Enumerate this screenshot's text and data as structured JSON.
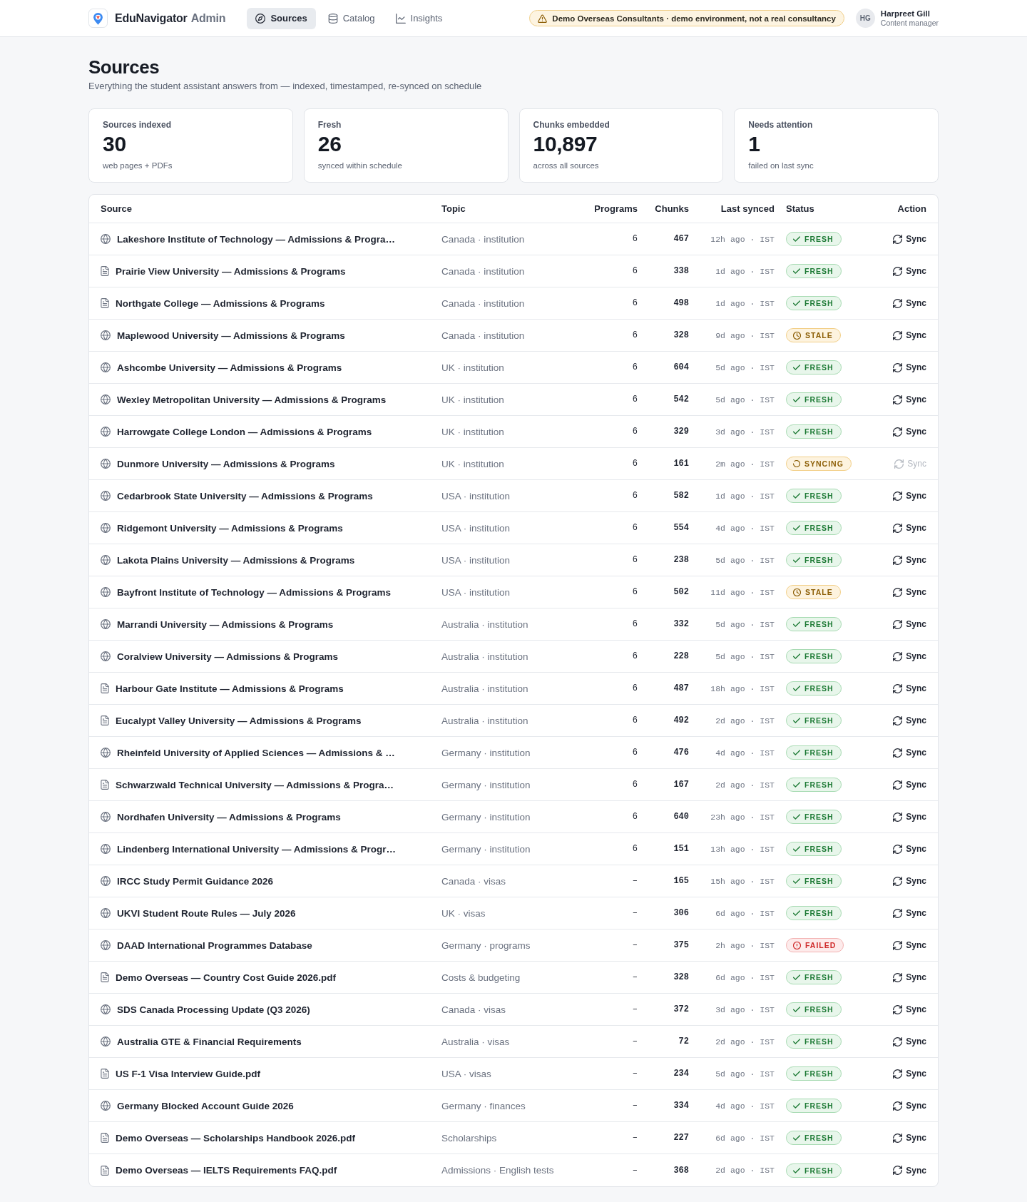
{
  "header": {
    "brand": {
      "name": "EduNavigator",
      "suffix": "Admin"
    },
    "nav": [
      {
        "label": "Sources",
        "selected": true
      },
      {
        "label": "Catalog",
        "selected": false
      },
      {
        "label": "Insights",
        "selected": false
      }
    ],
    "banner": {
      "text": "Demo Overseas Consultants · demo environment, not a real consultancy"
    },
    "user": {
      "initials": "HG",
      "name": "Harpreet Gill",
      "role": "Content manager"
    }
  },
  "page": {
    "title": "Sources",
    "subtitle": "Everything the student assistant answers from — indexed, timestamped, re-synced on schedule"
  },
  "stats": [
    {
      "label": "Sources indexed",
      "value": "30",
      "note": "web pages + PDFs"
    },
    {
      "label": "Fresh",
      "value": "26",
      "note": "synced within schedule"
    },
    {
      "label": "Chunks embedded",
      "value": "10,897",
      "note": "across all sources"
    },
    {
      "label": "Needs attention",
      "value": "1",
      "note": "failed on last sync"
    }
  ],
  "table": {
    "columns": [
      "Source",
      "Topic",
      "Programs",
      "Chunks",
      "Last synced",
      "Status",
      "Action"
    ],
    "rows": [
      {
        "kind": "web",
        "source": "Lakeshore Institute of Technology — Admissions & Progra…",
        "topic": "Canada · institution",
        "programs": "6",
        "chunks": "467",
        "last_synced": "12h ago · IST",
        "status": {
          "kind": "fresh",
          "label": "FRESH"
        },
        "action": {
          "label": "Sync",
          "disabled": false
        }
      },
      {
        "kind": "document",
        "source": "Prairie View University — Admissions & Programs",
        "topic": "Canada · institution",
        "programs": "6",
        "chunks": "338",
        "last_synced": "1d ago · IST",
        "status": {
          "kind": "fresh",
          "label": "FRESH"
        },
        "action": {
          "label": "Sync",
          "disabled": false
        }
      },
      {
        "kind": "document",
        "source": "Northgate College — Admissions & Programs",
        "topic": "Canada · institution",
        "programs": "6",
        "chunks": "498",
        "last_synced": "1d ago · IST",
        "status": {
          "kind": "fresh",
          "label": "FRESH"
        },
        "action": {
          "label": "Sync",
          "disabled": false
        }
      },
      {
        "kind": "web",
        "source": "Maplewood University — Admissions & Programs",
        "topic": "Canada · institution",
        "programs": "6",
        "chunks": "328",
        "last_synced": "9d ago · IST",
        "status": {
          "kind": "stale",
          "label": "STALE"
        },
        "action": {
          "label": "Sync",
          "disabled": false
        }
      },
      {
        "kind": "web",
        "source": "Ashcombe University — Admissions & Programs",
        "topic": "UK · institution",
        "programs": "6",
        "chunks": "604",
        "last_synced": "5d ago · IST",
        "status": {
          "kind": "fresh",
          "label": "FRESH"
        },
        "action": {
          "label": "Sync",
          "disabled": false
        }
      },
      {
        "kind": "web",
        "source": "Wexley Metropolitan University — Admissions & Programs",
        "topic": "UK · institution",
        "programs": "6",
        "chunks": "542",
        "last_synced": "5d ago · IST",
        "status": {
          "kind": "fresh",
          "label": "FRESH"
        },
        "action": {
          "label": "Sync",
          "disabled": false
        }
      },
      {
        "kind": "web",
        "source": "Harrowgate College London — Admissions & Programs",
        "topic": "UK · institution",
        "programs": "6",
        "chunks": "329",
        "last_synced": "3d ago · IST",
        "status": {
          "kind": "fresh",
          "label": "FRESH"
        },
        "action": {
          "label": "Sync",
          "disabled": false
        }
      },
      {
        "kind": "web",
        "source": "Dunmore University — Admissions & Programs",
        "topic": "UK · institution",
        "programs": "6",
        "chunks": "161",
        "last_synced": "2m ago · IST",
        "status": {
          "kind": "syncing",
          "label": "SYNCING"
        },
        "action": {
          "label": "Sync",
          "disabled": true
        }
      },
      {
        "kind": "web",
        "source": "Cedarbrook State University — Admissions & Programs",
        "topic": "USA · institution",
        "programs": "6",
        "chunks": "582",
        "last_synced": "1d ago · IST",
        "status": {
          "kind": "fresh",
          "label": "FRESH"
        },
        "action": {
          "label": "Sync",
          "disabled": false
        }
      },
      {
        "kind": "web",
        "source": "Ridgemont University — Admissions & Programs",
        "topic": "USA · institution",
        "programs": "6",
        "chunks": "554",
        "last_synced": "4d ago · IST",
        "status": {
          "kind": "fresh",
          "label": "FRESH"
        },
        "action": {
          "label": "Sync",
          "disabled": false
        }
      },
      {
        "kind": "web",
        "source": "Lakota Plains University — Admissions & Programs",
        "topic": "USA · institution",
        "programs": "6",
        "chunks": "238",
        "last_synced": "5d ago · IST",
        "status": {
          "kind": "fresh",
          "label": "FRESH"
        },
        "action": {
          "label": "Sync",
          "disabled": false
        }
      },
      {
        "kind": "web",
        "source": "Bayfront Institute of Technology — Admissions & Programs",
        "topic": "USA · institution",
        "programs": "6",
        "chunks": "502",
        "last_synced": "11d ago · IST",
        "status": {
          "kind": "stale",
          "label": "STALE"
        },
        "action": {
          "label": "Sync",
          "disabled": false
        }
      },
      {
        "kind": "web",
        "source": "Marrandi University — Admissions & Programs",
        "topic": "Australia · institution",
        "programs": "6",
        "chunks": "332",
        "last_synced": "5d ago · IST",
        "status": {
          "kind": "fresh",
          "label": "FRESH"
        },
        "action": {
          "label": "Sync",
          "disabled": false
        }
      },
      {
        "kind": "web",
        "source": "Coralview University — Admissions & Programs",
        "topic": "Australia · institution",
        "programs": "6",
        "chunks": "228",
        "last_synced": "5d ago · IST",
        "status": {
          "kind": "fresh",
          "label": "FRESH"
        },
        "action": {
          "label": "Sync",
          "disabled": false
        }
      },
      {
        "kind": "document",
        "source": "Harbour Gate Institute — Admissions & Programs",
        "topic": "Australia · institution",
        "programs": "6",
        "chunks": "487",
        "last_synced": "18h ago · IST",
        "status": {
          "kind": "fresh",
          "label": "FRESH"
        },
        "action": {
          "label": "Sync",
          "disabled": false
        }
      },
      {
        "kind": "document",
        "source": "Eucalypt Valley University — Admissions & Programs",
        "topic": "Australia · institution",
        "programs": "6",
        "chunks": "492",
        "last_synced": "2d ago · IST",
        "status": {
          "kind": "fresh",
          "label": "FRESH"
        },
        "action": {
          "label": "Sync",
          "disabled": false
        }
      },
      {
        "kind": "web",
        "source": "Rheinfeld University of Applied Sciences — Admissions & …",
        "topic": "Germany · institution",
        "programs": "6",
        "chunks": "476",
        "last_synced": "4d ago · IST",
        "status": {
          "kind": "fresh",
          "label": "FRESH"
        },
        "action": {
          "label": "Sync",
          "disabled": false
        }
      },
      {
        "kind": "document",
        "source": "Schwarzwald Technical University — Admissions & Progra…",
        "topic": "Germany · institution",
        "programs": "6",
        "chunks": "167",
        "last_synced": "2d ago · IST",
        "status": {
          "kind": "fresh",
          "label": "FRESH"
        },
        "action": {
          "label": "Sync",
          "disabled": false
        }
      },
      {
        "kind": "web",
        "source": "Nordhafen University — Admissions & Programs",
        "topic": "Germany · institution",
        "programs": "6",
        "chunks": "640",
        "last_synced": "23h ago · IST",
        "status": {
          "kind": "fresh",
          "label": "FRESH"
        },
        "action": {
          "label": "Sync",
          "disabled": false
        }
      },
      {
        "kind": "web",
        "source": "Lindenberg International University — Admissions & Progr…",
        "topic": "Germany · institution",
        "programs": "6",
        "chunks": "151",
        "last_synced": "13h ago · IST",
        "status": {
          "kind": "fresh",
          "label": "FRESH"
        },
        "action": {
          "label": "Sync",
          "disabled": false
        }
      },
      {
        "kind": "web",
        "source": "IRCC Study Permit Guidance 2026",
        "topic": "Canada · visas",
        "programs": "–",
        "chunks": "165",
        "last_synced": "15h ago · IST",
        "status": {
          "kind": "fresh",
          "label": "FRESH"
        },
        "action": {
          "label": "Sync",
          "disabled": false
        }
      },
      {
        "kind": "web",
        "source": "UKVI Student Route Rules — July 2026",
        "topic": "UK · visas",
        "programs": "–",
        "chunks": "306",
        "last_synced": "6d ago · IST",
        "status": {
          "kind": "fresh",
          "label": "FRESH"
        },
        "action": {
          "label": "Sync",
          "disabled": false
        }
      },
      {
        "kind": "web",
        "source": "DAAD International Programmes Database",
        "topic": "Germany · programs",
        "programs": "–",
        "chunks": "375",
        "last_synced": "2h ago · IST",
        "status": {
          "kind": "failed",
          "label": "FAILED"
        },
        "action": {
          "label": "Sync",
          "disabled": false
        }
      },
      {
        "kind": "document",
        "source": "Demo Overseas — Country Cost Guide 2026.pdf",
        "topic": "Costs & budgeting",
        "programs": "–",
        "chunks": "328",
        "last_synced": "6d ago · IST",
        "status": {
          "kind": "fresh",
          "label": "FRESH"
        },
        "action": {
          "label": "Sync",
          "disabled": false
        }
      },
      {
        "kind": "web",
        "source": "SDS Canada Processing Update (Q3 2026)",
        "topic": "Canada · visas",
        "programs": "–",
        "chunks": "372",
        "last_synced": "3d ago · IST",
        "status": {
          "kind": "fresh",
          "label": "FRESH"
        },
        "action": {
          "label": "Sync",
          "disabled": false
        }
      },
      {
        "kind": "web",
        "source": "Australia GTE & Financial Requirements",
        "topic": "Australia · visas",
        "programs": "–",
        "chunks": "72",
        "last_synced": "2d ago · IST",
        "status": {
          "kind": "fresh",
          "label": "FRESH"
        },
        "action": {
          "label": "Sync",
          "disabled": false
        }
      },
      {
        "kind": "document",
        "source": "US F-1 Visa Interview Guide.pdf",
        "topic": "USA · visas",
        "programs": "–",
        "chunks": "234",
        "last_synced": "5d ago · IST",
        "status": {
          "kind": "fresh",
          "label": "FRESH"
        },
        "action": {
          "label": "Sync",
          "disabled": false
        }
      },
      {
        "kind": "web",
        "source": "Germany Blocked Account Guide 2026",
        "topic": "Germany · finances",
        "programs": "–",
        "chunks": "334",
        "last_synced": "4d ago · IST",
        "status": {
          "kind": "fresh",
          "label": "FRESH"
        },
        "action": {
          "label": "Sync",
          "disabled": false
        }
      },
      {
        "kind": "document",
        "source": "Demo Overseas — Scholarships Handbook 2026.pdf",
        "topic": "Scholarships",
        "programs": "–",
        "chunks": "227",
        "last_synced": "6d ago · IST",
        "status": {
          "kind": "fresh",
          "label": "FRESH"
        },
        "action": {
          "label": "Sync",
          "disabled": false
        }
      },
      {
        "kind": "document",
        "source": "Demo Overseas — IELTS Requirements FAQ.pdf",
        "topic": "Admissions · English tests",
        "programs": "–",
        "chunks": "368",
        "last_synced": "2d ago · IST",
        "status": {
          "kind": "fresh",
          "label": "FRESH"
        },
        "action": {
          "label": "Sync",
          "disabled": false
        }
      }
    ]
  }
}
